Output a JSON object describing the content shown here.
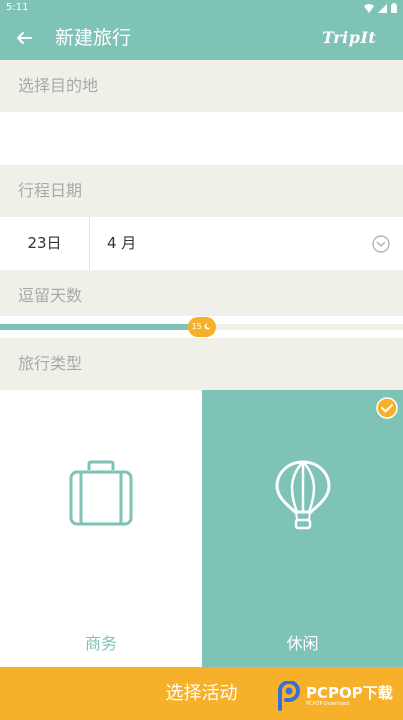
{
  "status_bar": {
    "time": "5:11"
  },
  "toolbar": {
    "title": "新建旅行",
    "logo": "TripIt"
  },
  "sections": {
    "destination_label": "选择目的地",
    "dates_label": "行程日期",
    "stay_label": "逗留天数",
    "trip_type_label": "旅行类型"
  },
  "dates": {
    "day": "23日",
    "month": "4 月"
  },
  "stay": {
    "days": 15,
    "min": 0,
    "max": 30,
    "badge": "15"
  },
  "trip_types": [
    {
      "label": "商务",
      "icon": "briefcase-icon",
      "selected": false
    },
    {
      "label": "休闲",
      "icon": "hot-air-balloon-icon",
      "selected": true
    }
  ],
  "cta": {
    "label": "选择活动"
  },
  "watermark": {
    "main": "PCPOP下载",
    "sub": "PCPOP Download"
  },
  "colors": {
    "teal": "#7fc2b6",
    "orange": "#f7b02a",
    "section_bg": "#f0efe8"
  }
}
